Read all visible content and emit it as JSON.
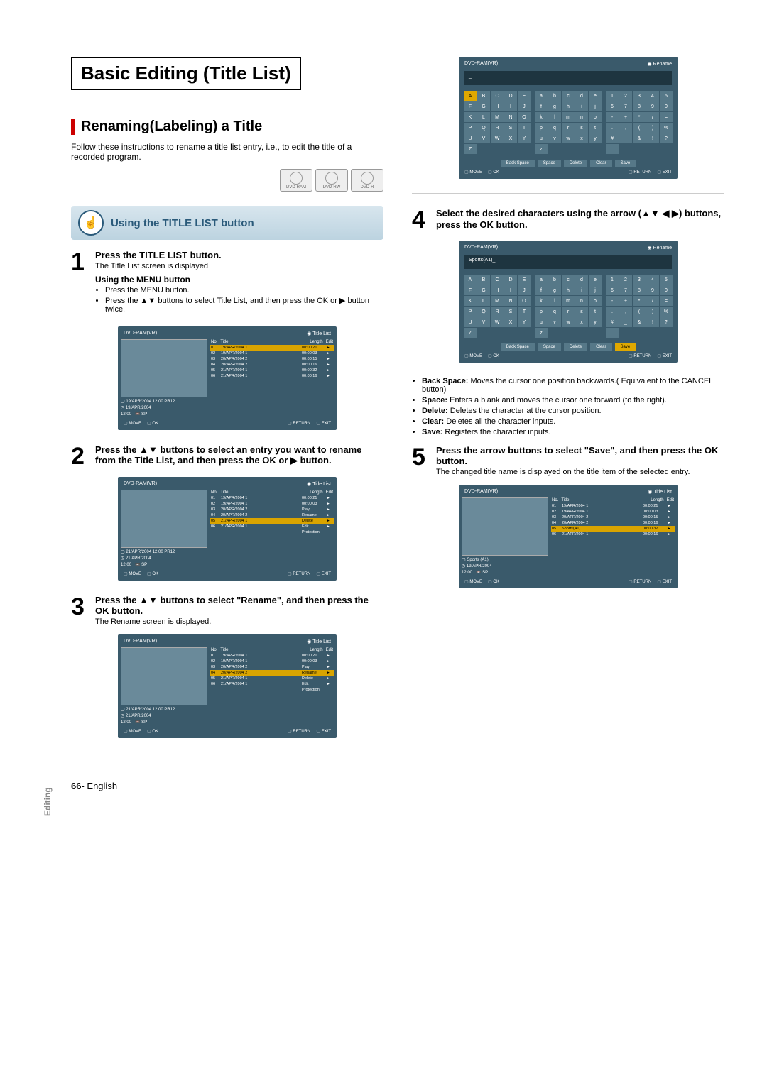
{
  "page": {
    "title": "Basic Editing (Title List)",
    "section": "Renaming(Labeling) a Title",
    "intro": "Follow these instructions to rename a title list entry, i.e., to edit the title of a recorded program.",
    "discs": [
      "DVD-RAM",
      "DVD-RW",
      "DVD-R"
    ],
    "subhead": "Using the TITLE LIST button",
    "side_label": "Editing",
    "footer_num": "66",
    "footer_lang": "- English"
  },
  "steps": {
    "s1": {
      "title": "Press the TITLE LIST button.",
      "sub": "The Title List screen is displayed",
      "h5": "Using the MENU button",
      "b1": "Press the MENU button.",
      "b2": "Press the ▲▼ buttons to select Title List, and then press the OK or ▶ button twice."
    },
    "s2": {
      "title": "Press the ▲▼ buttons to select an entry you want to rename from the Title List, and then press the OK or ▶ button."
    },
    "s3": {
      "title": "Press the ▲▼ buttons to select \"Rename\", and then press the OK button.",
      "sub": "The Rename screen is displayed."
    },
    "s4": {
      "title": "Select the desired characters using the arrow (▲▼ ◀ ▶) buttons, press the OK button."
    },
    "s5": {
      "title": "Press the arrow buttons to select \"Save\", and then press the OK button.",
      "sub": "The changed title name is displayed on the title item of the selected entry."
    }
  },
  "notes": {
    "back": "Back Space:",
    "back_t": " Moves the cursor one position backwards.( Equivalent to the CANCEL button)",
    "space": "Space:",
    "space_t": " Enters a blank and moves the cursor one forward (to the right).",
    "delete": "Delete:",
    "delete_t": " Deletes the character at the cursor position.",
    "clear": "Clear:",
    "clear_t": " Deletes all the character inputs.",
    "save": "Save:",
    "save_t": " Registers the character inputs."
  },
  "osd_common": {
    "mode": "DVD-RAM(VR)",
    "tl": "Title List",
    "rn": "Rename",
    "hdr_no": "No.",
    "hdr_title": "Title",
    "hdr_len": "Length",
    "hdr_edit": "Edit",
    "foot_move": "MOVE",
    "foot_ok": "OK",
    "foot_return": "RETURN",
    "foot_exit": "EXIT"
  },
  "osd1": {
    "info1": "19/APR/2004 12:00 PR12",
    "info2": "19/APR/2004",
    "info3": "12:00",
    "info4": "SP",
    "rows": [
      {
        "n": "01",
        "t": "19/APR/2004 1",
        "l": "00:00:21",
        "sel": true
      },
      {
        "n": "02",
        "t": "19/APR/2004 1",
        "l": "00:00:03"
      },
      {
        "n": "03",
        "t": "20/APR/2004 2",
        "l": "00:00:15"
      },
      {
        "n": "04",
        "t": "20/APR/2004 2",
        "l": "00:00:16"
      },
      {
        "n": "05",
        "t": "21/APR/2004 1",
        "l": "00:00:32"
      },
      {
        "n": "06",
        "t": "21/APR/2004 1",
        "l": "00:00:16"
      }
    ]
  },
  "osd2": {
    "info1": "21/APR/2004 12:00 PR12",
    "info2": "21/APR/2004",
    "info3": "12:00",
    "info4": "SP",
    "rows": [
      {
        "n": "01",
        "t": "19/APR/2004 1",
        "l": "00:00:21"
      },
      {
        "n": "02",
        "t": "19/APR/2004 1",
        "l": "00:00:03"
      },
      {
        "n": "03",
        "t": "20/APR/2004 2",
        "l": "Play"
      },
      {
        "n": "04",
        "t": "20/APR/2004 2",
        "l": "Rename"
      },
      {
        "n": "05",
        "t": "21/APR/2004 1",
        "l": "Delete",
        "sel": true
      },
      {
        "n": "06",
        "t": "21/APR/2004 1",
        "l": "Edit"
      }
    ],
    "popup": [
      "Play",
      "Rename",
      "Delete",
      "Edit",
      "Protection"
    ],
    "popup_extra": "Protection"
  },
  "osd3": {
    "info1": "21/APR/2004 12:00 PR12",
    "info2": "21/APR/2004",
    "info3": "12:00",
    "info4": "SP",
    "rows": [
      {
        "n": "01",
        "t": "19/APR/2004 1",
        "l": "00:00:21"
      },
      {
        "n": "02",
        "t": "19/APR/2004 1",
        "l": "00:00:03"
      },
      {
        "n": "03",
        "t": "20/APR/2004 2",
        "l": "Play"
      },
      {
        "n": "04",
        "t": "20/APR/2004 2",
        "l": "Rename",
        "sel": true
      },
      {
        "n": "05",
        "t": "21/APR/2004 1",
        "l": "Delete"
      },
      {
        "n": "06",
        "t": "21/APR/2004 1",
        "l": "Edit"
      }
    ],
    "popup_extra": "Protection"
  },
  "kbd": {
    "upper": [
      "A",
      "B",
      "C",
      "D",
      "E",
      "F",
      "G",
      "H",
      "I",
      "J",
      "K",
      "L",
      "M",
      "N",
      "O",
      "P",
      "Q",
      "R",
      "S",
      "T",
      "U",
      "V",
      "W",
      "X",
      "Y",
      "Z"
    ],
    "lower": [
      "a",
      "b",
      "c",
      "d",
      "e",
      "f",
      "g",
      "h",
      "i",
      "j",
      "k",
      "l",
      "m",
      "n",
      "o",
      "p",
      "q",
      "r",
      "s",
      "t",
      "u",
      "v",
      "w",
      "x",
      "y",
      "z"
    ],
    "num": [
      "1",
      "2",
      "3",
      "4",
      "5",
      "6",
      "7",
      "8",
      "9",
      "0",
      "-",
      "+",
      "*",
      "/",
      "=",
      ".",
      ",",
      "(",
      ")",
      "%",
      "#",
      "_",
      "&",
      "!",
      "?",
      " "
    ],
    "btn_back": "Back Space",
    "btn_space": "Space",
    "btn_delete": "Delete",
    "btn_clear": "Clear",
    "btn_save": "Save",
    "input2": "Sports(A1)_"
  },
  "osd5": {
    "info1": "Sports (A1)",
    "info2": "19/APR/2004",
    "info3": "12:00",
    "info4": "SP",
    "rows": [
      {
        "n": "01",
        "t": "19/APR/2004 1",
        "l": "00:00:21"
      },
      {
        "n": "02",
        "t": "19/APR/2004 1",
        "l": "00:00:03"
      },
      {
        "n": "03",
        "t": "20/APR/2004 2",
        "l": "00:00:15"
      },
      {
        "n": "04",
        "t": "20/APR/2004 2",
        "l": "00:00:16"
      },
      {
        "n": "05",
        "t": "Sports(A1)",
        "l": "00:00:32",
        "sel": true
      },
      {
        "n": "06",
        "t": "21/APR/2004 1",
        "l": "00:00:16"
      }
    ]
  }
}
